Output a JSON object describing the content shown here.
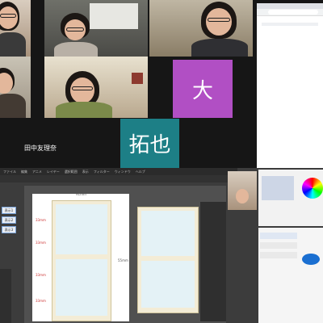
{
  "meeting": {
    "participant_name": "田中友理奈",
    "initial_purple": "大",
    "initial_teal": "拓也",
    "colors": {
      "purple": "#b14fc4",
      "teal": "#1d7f86"
    }
  },
  "browser": {
    "address": ""
  },
  "app": {
    "menu": [
      "ファイル",
      "編集",
      "アニメ",
      "レイヤー",
      "選択範囲",
      "表示",
      "フィルター",
      "ウィンドウ",
      "ヘルプ"
    ],
    "left_buttons": [
      "表示1",
      "表示2",
      "表示3"
    ],
    "labels": {
      "dim_top": "91mm",
      "dim_right": "55mm",
      "left_marks": [
        "33mm",
        "33mm",
        "33mm",
        "33mm"
      ]
    }
  }
}
